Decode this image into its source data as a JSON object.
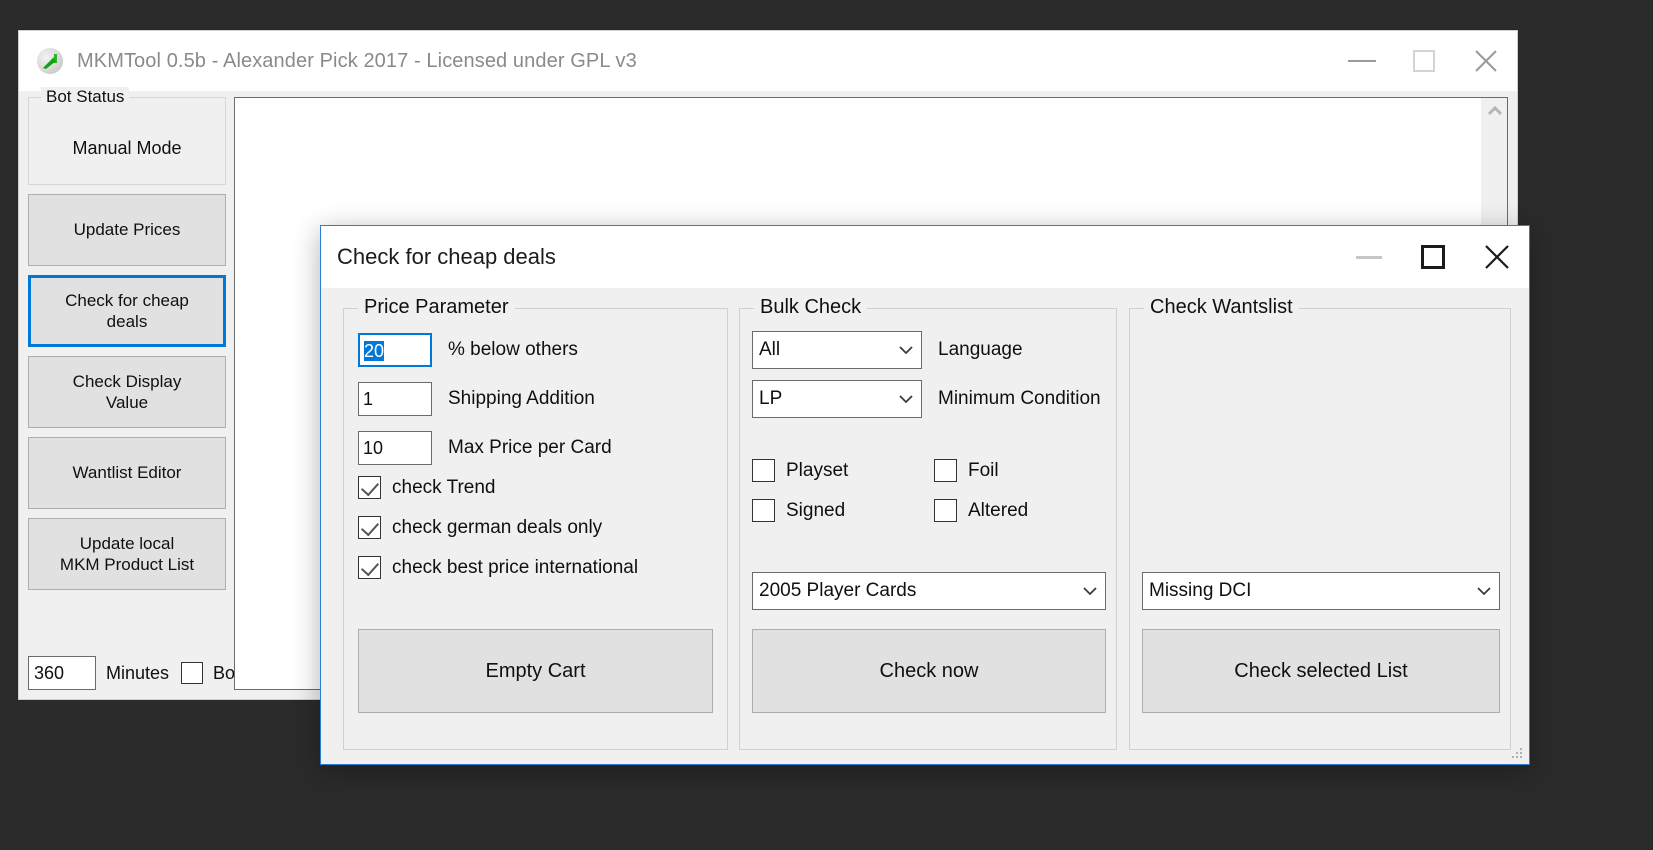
{
  "main_window": {
    "title": "MKMTool 0.5b - Alexander Pick 2017 - Licensed under GPL v3",
    "icon": "mkmtool-app-icon",
    "minimize_label": "—",
    "maximize_label": "□",
    "close_label": "✕",
    "sidebar": {
      "bot_status_group_title": "Bot Status",
      "bot_status_value": "Manual Mode",
      "buttons": [
        {
          "label": "Update Prices",
          "focused": false
        },
        {
          "label": "Check for cheap\ndeals",
          "focused": true
        },
        {
          "label": "Check Display\nValue",
          "focused": false
        },
        {
          "label": "Wantlist Editor",
          "focused": false
        },
        {
          "label": "Update local\nMKM Product List",
          "focused": false
        }
      ],
      "minutes_value": "360",
      "minutes_label": "Minutes",
      "botmode_label": "Bot Mode o",
      "botmode_checked": false
    },
    "log": {
      "content": "",
      "scroll_up_icon": "chevron-up-icon"
    }
  },
  "dialog": {
    "title": "Check for cheap deals",
    "minimize_label": "—",
    "maximize_label": "□",
    "close_label": "✕",
    "accent_color": "#2b7cd3",
    "price_parameter": {
      "group_title": "Price Parameter",
      "fields": [
        {
          "name": "percent-below-others",
          "value": "20",
          "label": "% below others",
          "focused": true,
          "selected": true
        },
        {
          "name": "shipping-addition",
          "value": "1",
          "label": "Shipping Addition",
          "focused": false,
          "selected": false
        },
        {
          "name": "max-price-per-card",
          "value": "10",
          "label": "Max Price per Card",
          "focused": false,
          "selected": false
        }
      ],
      "checkboxes": [
        {
          "name": "check-trend",
          "label": "check Trend",
          "checked": true
        },
        {
          "name": "check-german-deals-only",
          "label": "check german deals only",
          "checked": true
        },
        {
          "name": "check-best-price-international",
          "label": "check best price international",
          "checked": true
        }
      ],
      "button_label": "Empty Cart"
    },
    "bulk_check": {
      "group_title": "Bulk Check",
      "language": {
        "value": "All",
        "label": "Language"
      },
      "minimum_condition": {
        "value": "LP",
        "label": "Minimum Condition"
      },
      "checkboxes": [
        {
          "name": "playset",
          "label": "Playset",
          "checked": false
        },
        {
          "name": "foil",
          "label": "Foil",
          "checked": false
        },
        {
          "name": "signed",
          "label": "Signed",
          "checked": false
        },
        {
          "name": "altered",
          "label": "Altered",
          "checked": false
        }
      ],
      "expansion": {
        "value": "2005 Player Cards"
      },
      "button_label": "Check now"
    },
    "check_wantlist": {
      "group_title": "Check Wantslist",
      "list_select": {
        "value": "Missing DCI"
      },
      "button_label": "Check selected List"
    },
    "resize_grip": "resize-grip-icon"
  }
}
